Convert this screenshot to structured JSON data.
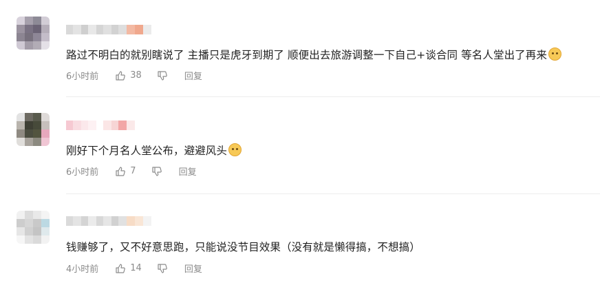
{
  "comments": [
    {
      "text": "路过不明白的就别瞎说了 主播只是虎牙到期了 顺便出去旅游调整一下自己+谈合同 等名人堂出了再来",
      "emoji": "cat-face-emoji",
      "time": "6小时前",
      "likes": "38",
      "reply_label": "回复",
      "avatar_colors": [
        "#d8d2dc",
        "#a6a0ac",
        "#8d8a96",
        "#d2cdd6",
        "#9b93a0",
        "#7a7283",
        "#6b6375",
        "#b5aeb9",
        "#8c8592",
        "#77707d",
        "#8e8797",
        "#c4bdc9",
        "#cfc9d4",
        "#a39ca8",
        "#b2acb6",
        "#e4e0e7"
      ],
      "name_colors": [
        "#d9d9d9",
        "#e3e3e3",
        "#cfcfcf",
        "#e8e8e8",
        "#d5d5d5",
        "#e0e0e0",
        "#d2d2d2",
        "#dedede",
        "#f3b9a3",
        "#f0a88d",
        "#ebebeb"
      ]
    },
    {
      "text": "刚好下个月名人堂公布，避避风头",
      "emoji": "cat-face-emoji",
      "time": "6小时前",
      "likes": "7",
      "reply_label": "回复",
      "avatar_colors": [
        "#e3e3e3",
        "#6d6a62",
        "#585a4c",
        "#dedad8",
        "#b9b4ad",
        "#3e3f34",
        "#474a3a",
        "#c7c0bc",
        "#8f8a82",
        "#4b4d40",
        "#52543f",
        "#e7a8bd",
        "#e0dedb",
        "#a8a39c",
        "#8c8a80",
        "#f0c6d4"
      ],
      "name_colors": [
        "#f6c9d2",
        "#f9dde2",
        "#fbe8eb",
        "#fdf1f3",
        "#ffffff",
        "#fbe6e6",
        "#f7d5d5",
        "#f2a7a7",
        "#fbe9e9"
      ]
    },
    {
      "text": "钱赚够了，又不好意思跑，只能说没节目效果（没有就是懒得搞，不想搞）",
      "emoji": "",
      "time": "4小时前",
      "likes": "14",
      "reply_label": "回复",
      "avatar_colors": [
        "#f1f1f1",
        "#dcdcdc",
        "#e9e9e9",
        "#f4f4f4",
        "#cdcdcd",
        "#d6d6d6",
        "#c9c9c9",
        "#bcd9e3",
        "#e6e6e6",
        "#d0d0d0",
        "#c4c4c4",
        "#dfe9ec",
        "#f6f6f6",
        "#e3e3e3",
        "#dadada",
        "#f2f2f2"
      ],
      "name_colors": [
        "#dadada",
        "#e4e4e4",
        "#d4d4d4",
        "#ebebeb",
        "#d8d8d8",
        "#e6e6e6",
        "#d1d1d1",
        "#e1e1e1",
        "#f7dcc6",
        "#f9e6d6",
        "#f3f3f3"
      ]
    }
  ]
}
